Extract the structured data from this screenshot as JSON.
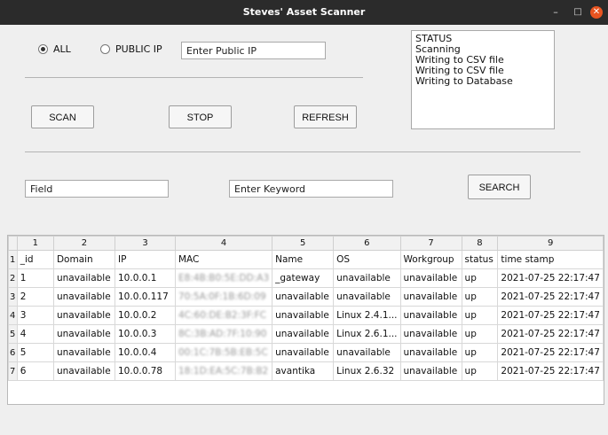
{
  "window": {
    "title": "Steves' Asset Scanner",
    "minimize": "–",
    "maximize": "□",
    "close": "✕"
  },
  "radios": {
    "all": {
      "label": "ALL",
      "selected": true
    },
    "public_ip": {
      "label": "PUBLIC IP",
      "selected": false
    }
  },
  "inputs": {
    "public_ip": "Enter Public IP",
    "field": "Field",
    "keyword": "Enter Keyword"
  },
  "buttons": {
    "scan": "SCAN",
    "stop": "STOP",
    "refresh": "REFRESH",
    "search": "SEARCH"
  },
  "status_log": [
    "STATUS",
    "Scanning",
    "Writing to CSV file",
    "Writing to CSV file",
    "Writing to Database"
  ],
  "table": {
    "column_numbers": [
      "1",
      "2",
      "3",
      "4",
      "5",
      "6",
      "7",
      "8",
      "9"
    ],
    "row_numbers": [
      "1",
      "2",
      "3",
      "4",
      "5",
      "6",
      "7"
    ],
    "rows": [
      [
        "_id",
        "Domain",
        "IP",
        "MAC",
        "Name",
        "OS",
        "Workgroup",
        "status",
        "time stamp"
      ],
      [
        "1",
        "unavailable",
        "10.0.0.1",
        "E8:4B:B0:5E:DD:A3",
        "_gateway",
        "unavailable",
        "unavailable",
        "up",
        "2021-07-25 22:17:47"
      ],
      [
        "2",
        "unavailable",
        "10.0.0.117",
        "70:5A:0F:1B:6D:09",
        "unavailable",
        "unavailable",
        "unavailable",
        "up",
        "2021-07-25 22:17:47"
      ],
      [
        "3",
        "unavailable",
        "10.0.0.2",
        "4C:60:DE:B2:3F:FC",
        "unavailable",
        "Linux 2.4.1...",
        "unavailable",
        "up",
        "2021-07-25 22:17:47"
      ],
      [
        "4",
        "unavailable",
        "10.0.0.3",
        "8C:3B:AD:7F:10:90",
        "unavailable",
        "Linux 2.6.1...",
        "unavailable",
        "up",
        "2021-07-25 22:17:47"
      ],
      [
        "5",
        "unavailable",
        "10.0.0.4",
        "00:1C:7B:5B:EB:5C",
        "unavailable",
        "unavailable",
        "unavailable",
        "up",
        "2021-07-25 22:17:47"
      ],
      [
        "6",
        "unavailable",
        "10.0.0.78",
        "18:1D:EA:5C:7B:B2",
        "avantika",
        "Linux 2.6.32",
        "unavailable",
        "up",
        "2021-07-25 22:17:47"
      ]
    ]
  }
}
